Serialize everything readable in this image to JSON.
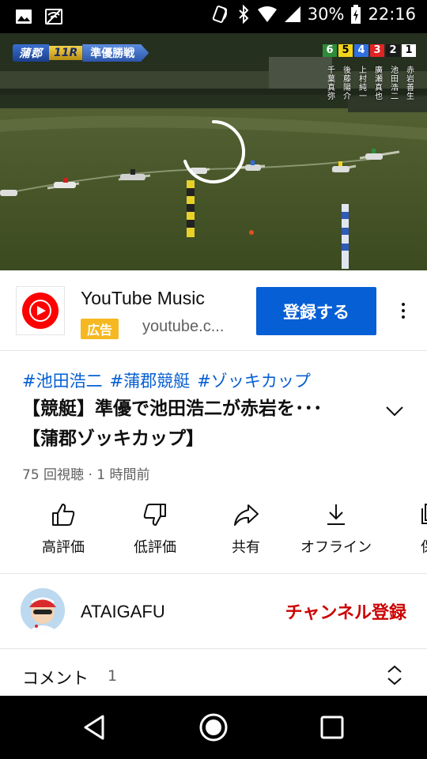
{
  "status_bar": {
    "battery": "30%",
    "time": "22:16"
  },
  "video": {
    "venue": "蒲郡",
    "race": "11R",
    "stage": "準優勝戦",
    "lanes": [
      {
        "num": "6",
        "name": "千葉真弥",
        "bg": "#2e8b3a",
        "fg": "#ffffff"
      },
      {
        "num": "5",
        "name": "後藤陽介",
        "bg": "#f2d31c",
        "fg": "#000000"
      },
      {
        "num": "4",
        "name": "上村純一",
        "bg": "#2f6fe0",
        "fg": "#ffffff"
      },
      {
        "num": "3",
        "name": "廣瀬真也",
        "bg": "#e02424",
        "fg": "#ffffff"
      },
      {
        "num": "2",
        "name": "池田浩二",
        "bg": "#1a1a1a",
        "fg": "#ffffff"
      },
      {
        "num": "1",
        "name": "赤岩善生",
        "bg": "#ffffff",
        "fg": "#000000"
      }
    ],
    "progress": 0.135
  },
  "ad": {
    "title": "YouTube Music",
    "badge": "広告",
    "url": "youtube.c...",
    "cta": "登録する",
    "colors": {
      "cta": "#065fd4",
      "badge": "#f5b820",
      "logo": "#ff0000"
    }
  },
  "video_info": {
    "hashtags": [
      "#池田浩二",
      "#蒲郡競艇",
      "#ゾッキカップ"
    ],
    "title": "【競艇】準優で池田浩二が赤岩を･･･【蒲郡ゾッキカップ】",
    "meta": "75 回視聴 · 1 時間前"
  },
  "actions": [
    {
      "label": "高評価",
      "icon": "thumb-up-icon"
    },
    {
      "label": "低評価",
      "icon": "thumb-down-icon"
    },
    {
      "label": "共有",
      "icon": "share-icon"
    },
    {
      "label": "オフライン",
      "icon": "download-icon"
    },
    {
      "label": "保",
      "icon": "save-icon"
    }
  ],
  "channel": {
    "name": "ATAIGAFU",
    "subscribe": "チャンネル登録"
  },
  "comments": {
    "label": "コメント",
    "count": "1"
  }
}
